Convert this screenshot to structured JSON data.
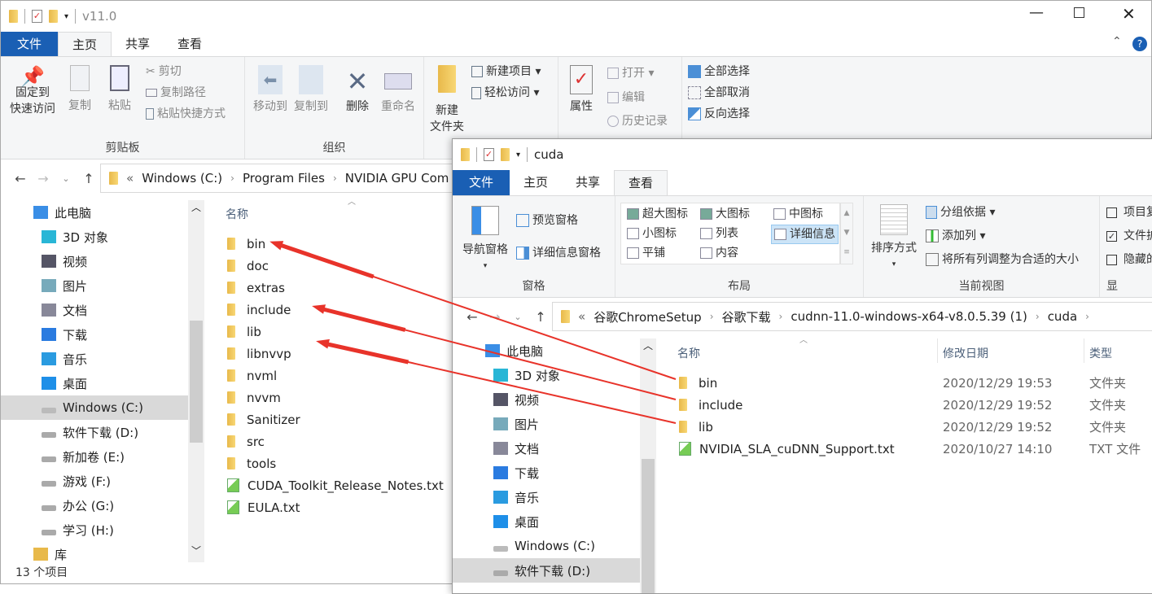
{
  "left": {
    "title": "v11.0",
    "tabs": [
      "文件",
      "主页",
      "共享",
      "查看"
    ],
    "ribbon": {
      "clipboard": {
        "label": "剪贴板",
        "pin": [
          "固定到",
          "快速访问"
        ],
        "copy": "复制",
        "paste": "粘贴",
        "cut": "剪切",
        "copy_path": "复制路径",
        "paste_shortcut": "粘贴快捷方式"
      },
      "organize": {
        "label": "组织",
        "move_to": "移动到",
        "copy_to": "复制到",
        "delete": "删除",
        "rename": "重命名"
      },
      "new": {
        "new_folder": [
          "新建",
          "文件夹"
        ],
        "new_item": "新建项目",
        "easy_access": "轻松访问"
      },
      "open": {
        "properties": "属性",
        "open": "打开",
        "edit": "编辑",
        "history": "历史记录"
      },
      "select": {
        "select_all": "全部选择",
        "select_none": "全部取消",
        "invert": "反向选择"
      }
    },
    "address": {
      "crumbs": [
        "Windows (C:)",
        "Program Files",
        "NVIDIA GPU Com"
      ]
    },
    "nav": [
      "此电脑",
      "3D 对象",
      "视频",
      "图片",
      "文档",
      "下载",
      "音乐",
      "桌面",
      "Windows (C:)",
      "软件下载 (D:)",
      "新加卷 (E:)",
      "游戏 (F:)",
      "办公 (G:)",
      "学习 (H:)",
      "库"
    ],
    "column_name": "名称",
    "files": [
      {
        "name": "bin",
        "type": "folder"
      },
      {
        "name": "doc",
        "type": "folder"
      },
      {
        "name": "extras",
        "type": "folder"
      },
      {
        "name": "include",
        "type": "folder"
      },
      {
        "name": "lib",
        "type": "folder"
      },
      {
        "name": "libnvvp",
        "type": "folder"
      },
      {
        "name": "nvml",
        "type": "folder"
      },
      {
        "name": "nvvm",
        "type": "folder"
      },
      {
        "name": "Sanitizer",
        "type": "folder"
      },
      {
        "name": "src",
        "type": "folder"
      },
      {
        "name": "tools",
        "type": "folder"
      },
      {
        "name": "CUDA_Toolkit_Release_Notes.txt",
        "type": "txt"
      },
      {
        "name": "EULA.txt",
        "type": "txt"
      }
    ],
    "status": "13 个项目"
  },
  "right": {
    "title": "cuda",
    "tabs": [
      "文件",
      "主页",
      "共享",
      "查看"
    ],
    "ribbon": {
      "panes": {
        "label": "窗格",
        "nav_pane": "导航窗格",
        "preview": "预览窗格",
        "details": "详细信息窗格"
      },
      "layout": {
        "label": "布局",
        "items": [
          "超大图标",
          "大图标",
          "中图标",
          "小图标",
          "列表",
          "详细信息",
          "平铺",
          "内容"
        ]
      },
      "current_view": {
        "label": "当前视图",
        "sort": "排序方式",
        "group": "分组依据",
        "add_col": "添加列",
        "fit": "将所有列调整为合适的大小"
      },
      "show": {
        "label": "显",
        "items": [
          {
            "label": "项目复",
            "checked": false
          },
          {
            "label": "文件扩",
            "checked": true
          },
          {
            "label": "隐藏的",
            "checked": false
          }
        ]
      }
    },
    "address": {
      "crumbs": [
        "谷歌ChromeSetup",
        "谷歌下载",
        "cudnn-11.0-windows-x64-v8.0.5.39 (1)",
        "cuda"
      ]
    },
    "nav": [
      "此电脑",
      "3D 对象",
      "视频",
      "图片",
      "文档",
      "下载",
      "音乐",
      "桌面",
      "Windows (C:)",
      "软件下载 (D:)"
    ],
    "columns": [
      "名称",
      "修改日期",
      "类型"
    ],
    "files": [
      {
        "name": "bin",
        "date": "2020/12/29 19:53",
        "type": "文件夹"
      },
      {
        "name": "include",
        "date": "2020/12/29 19:52",
        "type": "文件夹"
      },
      {
        "name": "lib",
        "date": "2020/12/29 19:52",
        "type": "文件夹"
      },
      {
        "name": "NVIDIA_SLA_cuDNN_Support.txt",
        "date": "2020/10/27 14:10",
        "type": "TXT 文件"
      }
    ]
  },
  "annotation_color": "#e8332a",
  "accent": "#1a5fb4"
}
